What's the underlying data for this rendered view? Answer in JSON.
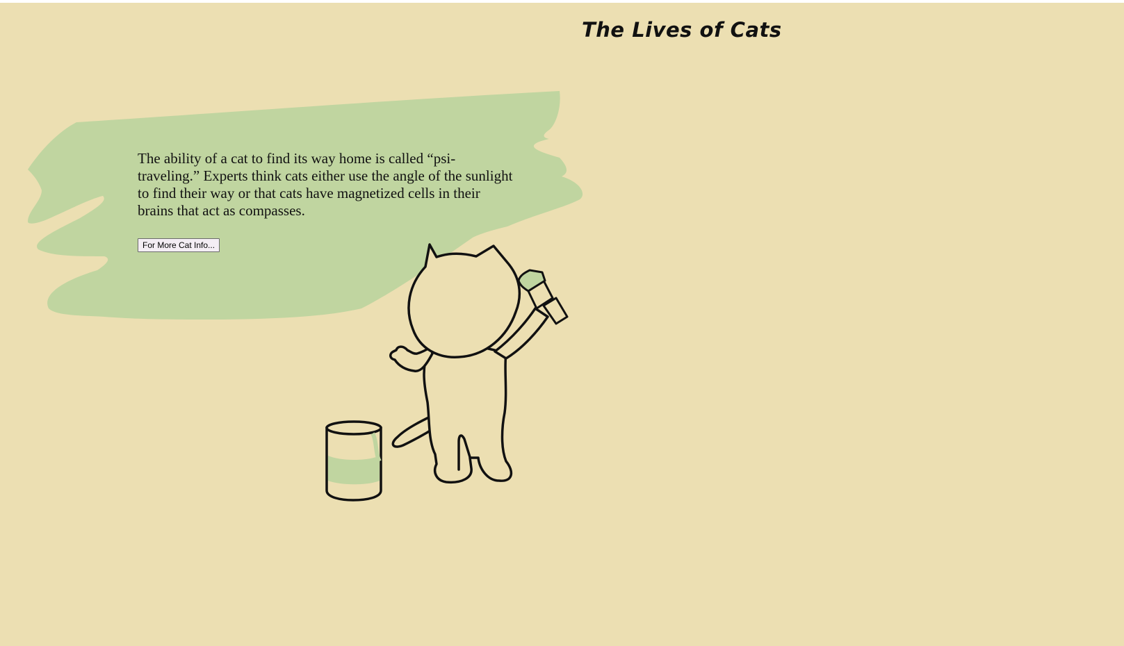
{
  "page": {
    "title": "The Lives of Cats",
    "fact_text": "The ability of a cat to find its way home is called “psi-traveling.” Experts think cats either use the angle of the sunlight to find their way or that cats have magnetized cells in their brains that act as compasses.",
    "more_button_label": "For More Cat Info..."
  },
  "colors": {
    "background": "#ecdfb2",
    "paint_green": "#c0d5a0",
    "outline": "#111111"
  },
  "illustration": {
    "subject": "cat-painting-wall",
    "parts": [
      "paint-brush-stroke",
      "cat-icon",
      "paint-brush-icon",
      "paint-can-icon"
    ]
  }
}
